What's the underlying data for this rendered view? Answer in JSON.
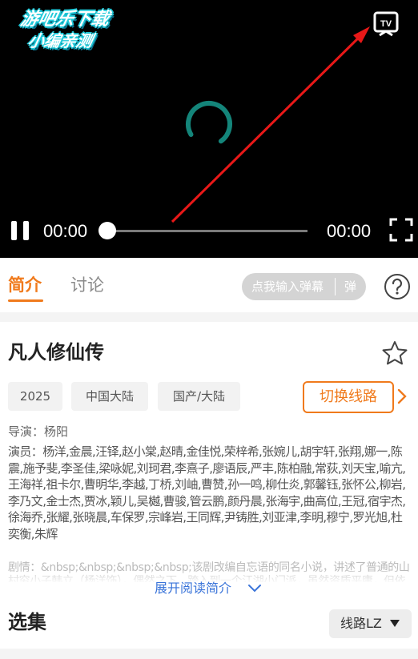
{
  "player": {
    "watermark_line1": "游吧乐下载",
    "watermark_line2": "小编亲测",
    "current_time": "00:00",
    "total_time": "00:00",
    "progress": 0,
    "accent_color": "#14857a"
  },
  "tabs": {
    "intro": "简介",
    "discuss": "讨论",
    "danmaku_input": "点我输入弹幕",
    "danmaku_toggle": "弹"
  },
  "show": {
    "title": "凡人修仙传",
    "year": "2025",
    "region": "中国大陆",
    "genre": "国产/大陆",
    "switch_line": "切换线路",
    "director": "导演：杨阳",
    "cast": "演员：杨洋,金晨,汪铎,赵小棠,赵晴,金佳悦,荣梓希,张婉儿,胡宇轩,张翔,娜一,陈震,施予斐,李圣佳,梁咏妮,刘珂君,李熹子,廖语辰,严丰,陈柏融,常荻,刘天宝,喻亢,王海祥,祖卡尔,曹明华,李越,丁桥,刘岫,曹赞,孙一鸣,柳仕炎,郭馨钰,张怀公,柳岩,李乃文,金士杰,贾冰,颖儿,吴樾,曹骏,管云鹏,颜丹晨,张海宇,曲高位,王冠,宿宇杰,徐海乔,张耀,张晓晨,车保罗,宗峰岩,王同辉,尹铸胜,刘亚津,李明,穆宁,罗光旭,杜奕衡,朱辉",
    "plot": "剧情：&nbsp;&nbsp;&nbsp;&nbsp;该剧改编自忘语的同名小说，讲述了普通的山村穷小子韩立（杨洋饰），偶然之下，跨入到一个江湖小门派，虽然资质平庸，但依靠自身努力和合理算计最后修炼成仙的故事。",
    "expand": "展开阅读简介"
  },
  "episodes": {
    "title": "选集",
    "route": "线路LZ"
  },
  "colors": {
    "accent": "#f07a1c",
    "link": "#3a74d9",
    "arrow": "#e81818"
  }
}
